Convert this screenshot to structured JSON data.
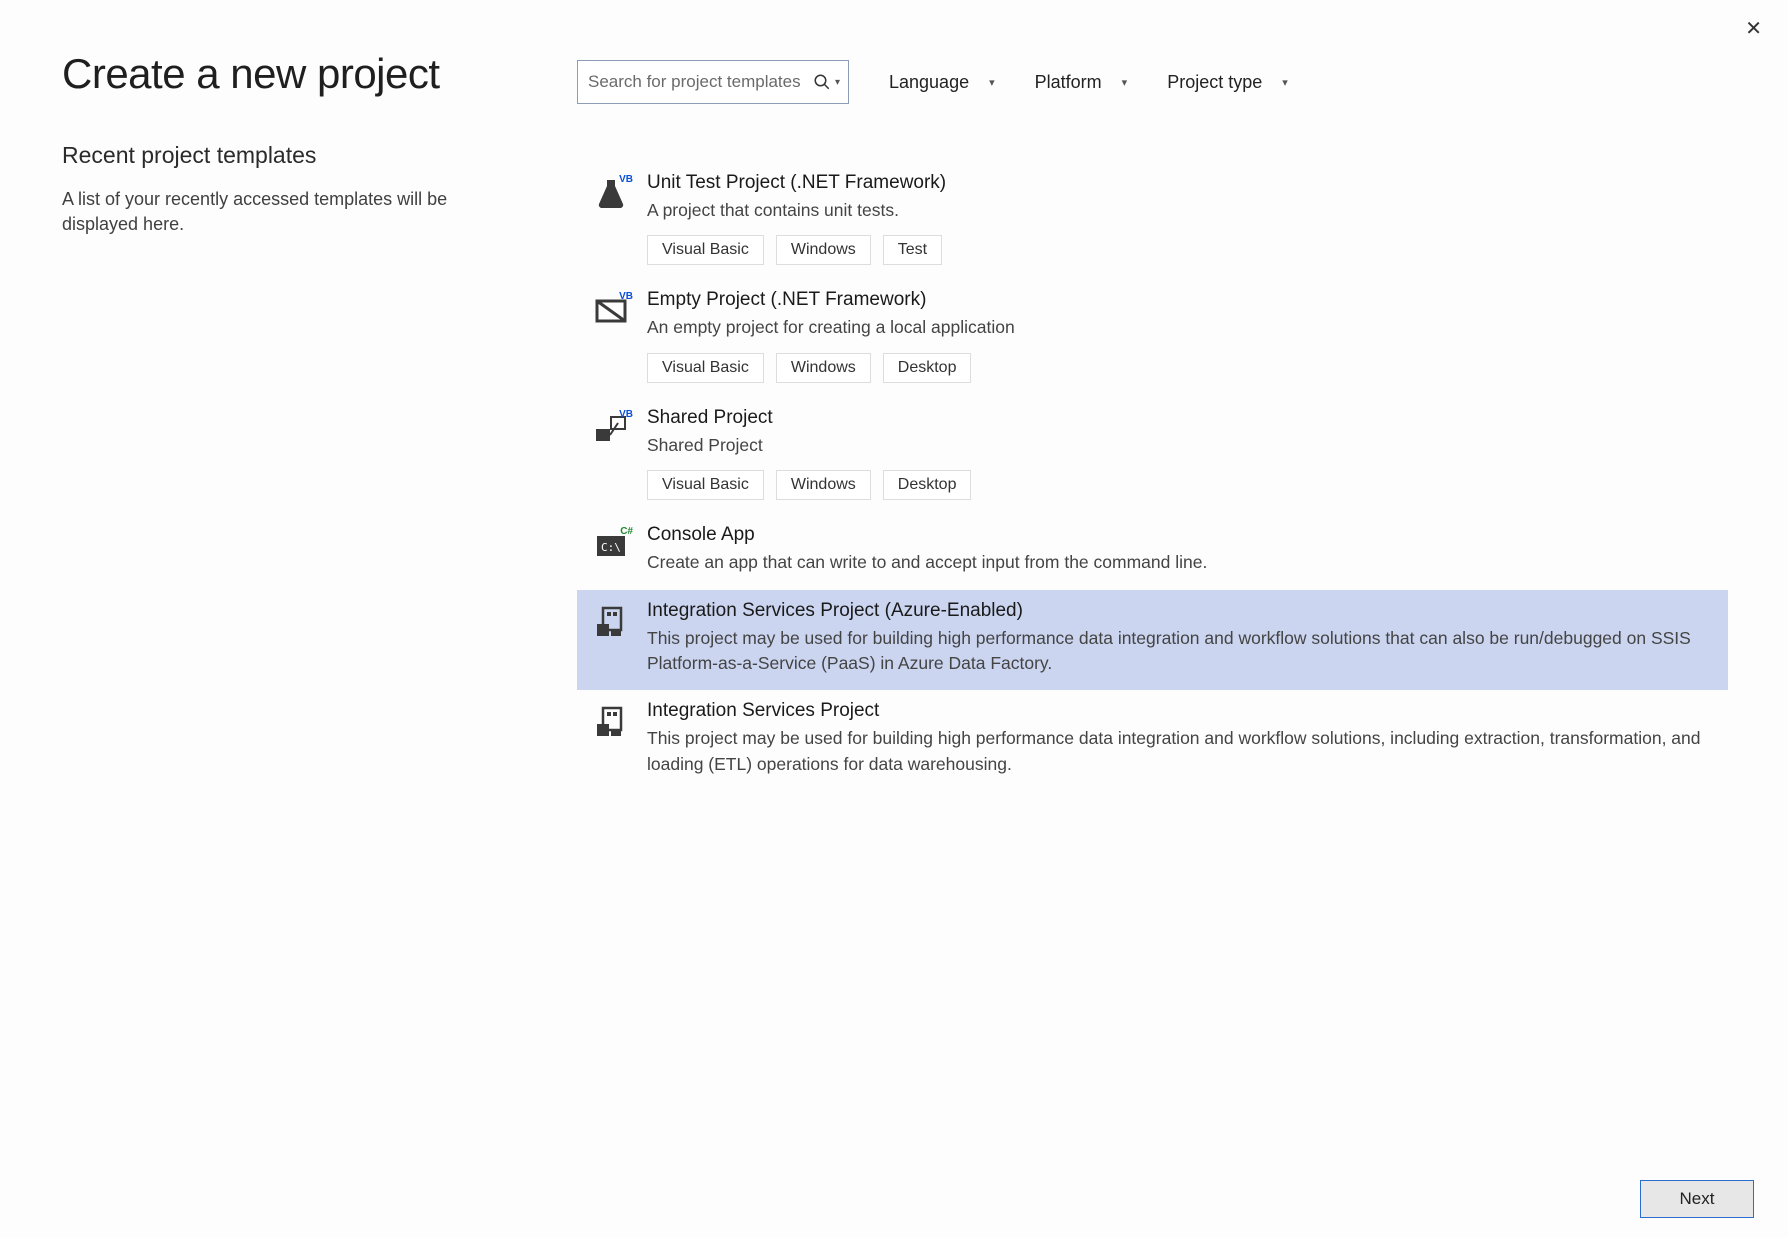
{
  "close_label": "✕",
  "title": "Create a new project",
  "recent": {
    "heading": "Recent project templates",
    "empty_message": "A list of your recently accessed templates will be displayed here."
  },
  "search": {
    "placeholder": "Search for project templates"
  },
  "filters": {
    "language": "Language",
    "platform": "Platform",
    "project_type": "Project type"
  },
  "templates": [
    {
      "title": "Unit Test Project (.NET Framework)",
      "description": "A project that contains unit tests.",
      "tags": [
        "Visual Basic",
        "Windows",
        "Test"
      ],
      "icon": "flask-vb",
      "selected": false
    },
    {
      "title": "Empty Project (.NET Framework)",
      "description": "An empty project for creating a local application",
      "tags": [
        "Visual Basic",
        "Windows",
        "Desktop"
      ],
      "icon": "empty-vb",
      "selected": false
    },
    {
      "title": "Shared Project",
      "description": "Shared Project",
      "tags": [
        "Visual Basic",
        "Windows",
        "Desktop"
      ],
      "icon": "shared-vb",
      "selected": false
    },
    {
      "title": "Console App",
      "description": "Create an app that can write to and accept input from the command line.",
      "tags": [],
      "icon": "console-cs",
      "selected": false
    },
    {
      "title": "Integration Services Project (Azure-Enabled)",
      "description": "This project may be used for building high performance data integration and workflow solutions that can also be run/debugged on SSIS Platform-as-a-Service (PaaS) in Azure Data Factory.",
      "tags": [],
      "icon": "ssis",
      "selected": true
    },
    {
      "title": "Integration Services Project",
      "description": "This project may be used for building high performance data integration and workflow solutions, including extraction, transformation, and loading (ETL) operations for data warehousing.",
      "tags": [],
      "icon": "ssis",
      "selected": false
    }
  ],
  "next_button": "Next"
}
